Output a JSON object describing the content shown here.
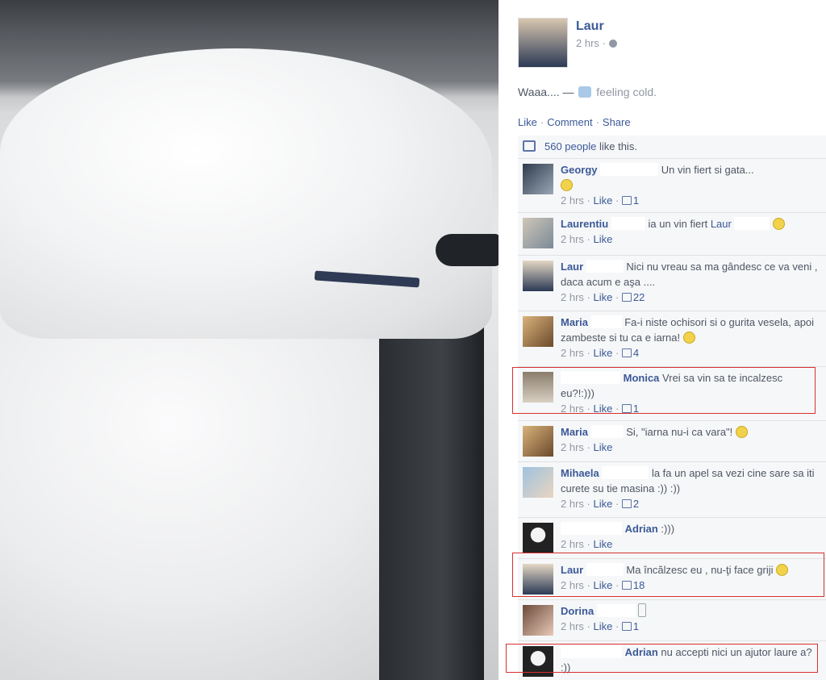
{
  "post": {
    "author": "Laur",
    "time": "2 hrs ·",
    "status_text": "Waaa.... —",
    "feeling": "feeling cold.",
    "actions": {
      "like": "Like",
      "comment": "Comment",
      "share": "Share"
    },
    "likes": {
      "count": "560 people",
      "suffix": "like this."
    }
  },
  "comments": [
    {
      "name": "Georgy",
      "text": "Un vin fiert si gata...",
      "time": "2 hrs",
      "like": "Like",
      "likes": "1"
    },
    {
      "name": "Laurentiu",
      "text": "ia un vin fiert",
      "mention": "Laur",
      "time": "2 hrs",
      "like": "Like",
      "likes": ""
    },
    {
      "name": "Laur",
      "text": "Nici nu vreau sa ma gândesc ce va veni , daca acum e aşa ....",
      "time": "2 hrs",
      "like": "Like",
      "likes": "22"
    },
    {
      "name": "Maria",
      "text": "Fa-i niste ochisori si o gurita vesela, apoi zambeste si tu ca e iarna!",
      "time": "2 hrs",
      "like": "Like",
      "likes": "4"
    },
    {
      "name": "Monica",
      "text": "Vrei sa vin sa te incalzesc eu?!:)))",
      "time": "2 hrs",
      "like": "Like",
      "likes": "1"
    },
    {
      "name": "Maria",
      "text": "Si, \"iarna nu-i ca vara\"!",
      "time": "2 hrs",
      "like": "Like",
      "likes": ""
    },
    {
      "name": "Mihaela",
      "text": "la fa un apel sa vezi cine sare sa iti curete su tie masina :)) :))",
      "time": "2 hrs",
      "like": "Like",
      "likes": "2"
    },
    {
      "name": "Adrian",
      "text": ":)))",
      "time": "2 hrs",
      "like": "Like",
      "likes": ""
    },
    {
      "name": "Laur",
      "text": "Ma încălzesc eu , nu-ţi face griji",
      "time": "2 hrs",
      "like": "Like",
      "likes": "18"
    },
    {
      "name": "Dorina",
      "text": "",
      "time": "2 hrs",
      "like": "Like",
      "likes": "1"
    },
    {
      "name": "Adrian",
      "text": "nu accepti nici un ajutor laure a? :))",
      "time": "",
      "like": "",
      "likes": ""
    }
  ],
  "colors": {
    "link": "#3b5998",
    "meta": "#9197a3",
    "highlight": "#d83030"
  }
}
